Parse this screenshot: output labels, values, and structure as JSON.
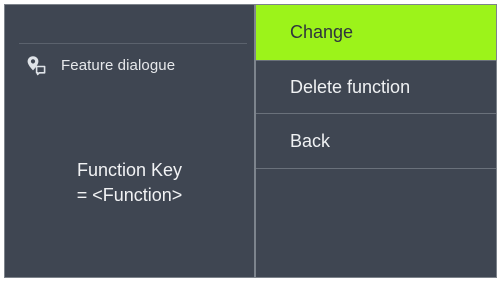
{
  "left_panel": {
    "feature_title": "Feature dialogue",
    "feature_icon": "map-pin-dialog-icon",
    "function_line1": "Function Key",
    "function_line2": "= <Function>"
  },
  "menu": {
    "items": [
      {
        "label": "Change",
        "active": true
      },
      {
        "label": "Delete function",
        "active": false
      },
      {
        "label": "Back",
        "active": false
      },
      {
        "label": "",
        "active": false
      }
    ],
    "accent_color": "#9cf31a"
  },
  "colors": {
    "background": "#3f4652",
    "text": "#eff1f3",
    "divider": "#7d848d"
  }
}
